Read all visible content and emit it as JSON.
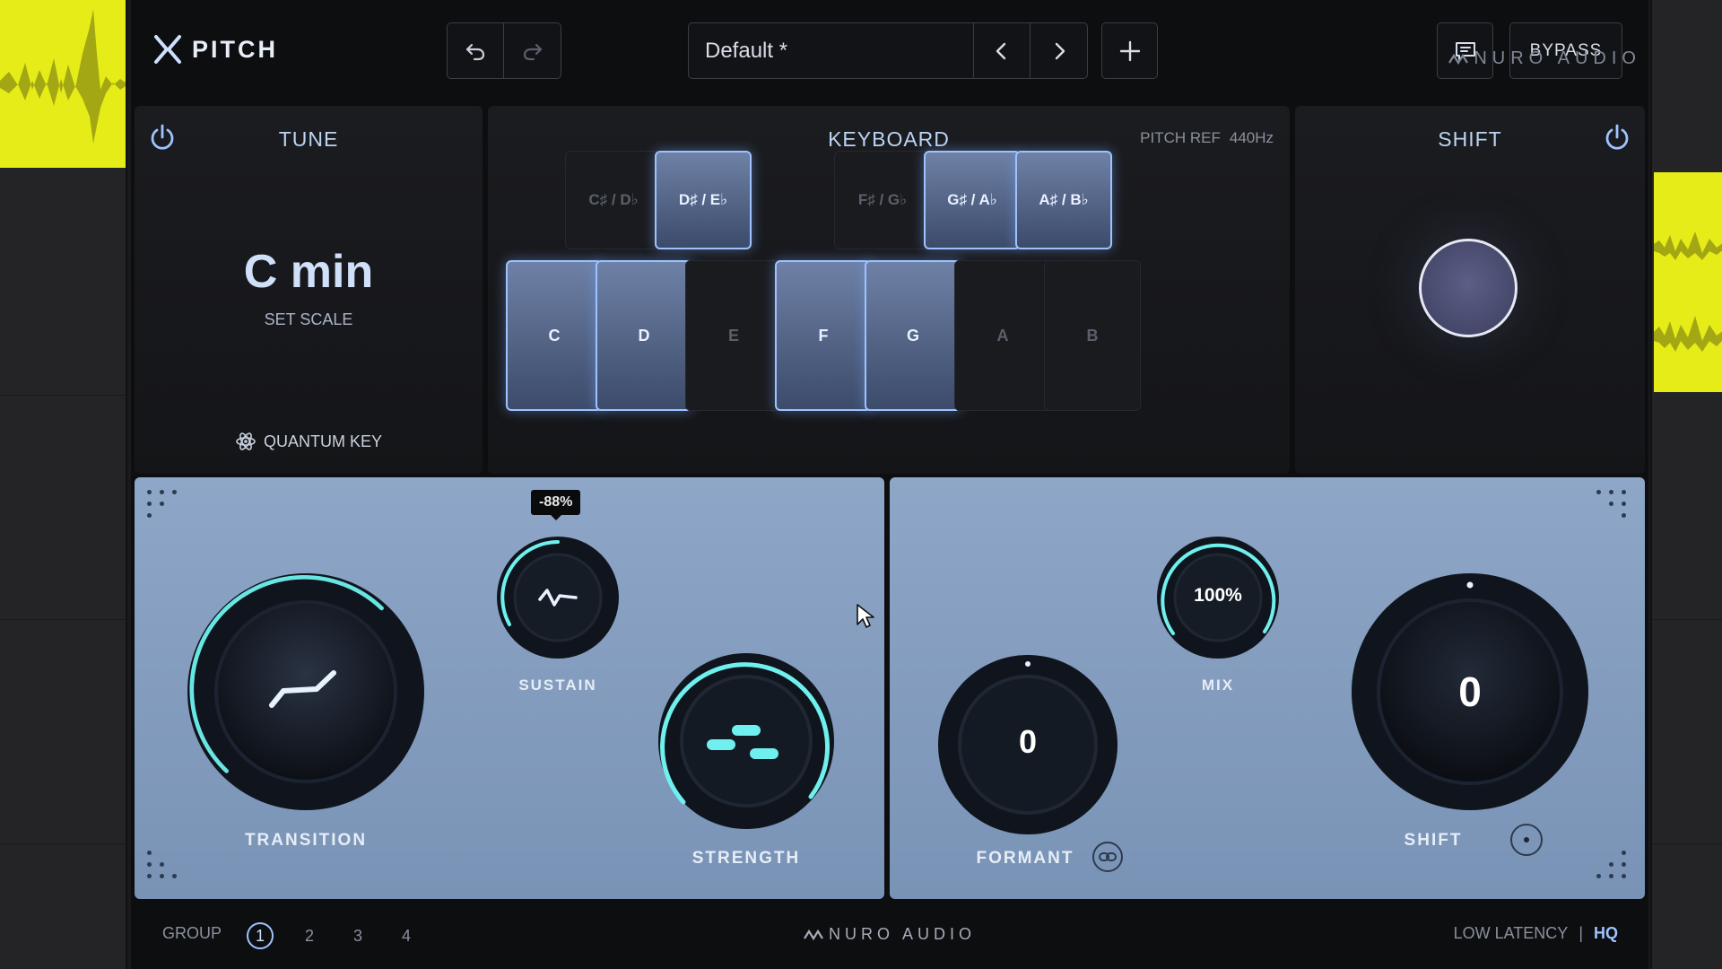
{
  "header": {
    "app_name": "PITCH",
    "preset_name": "Default *",
    "bypass_label": "BYPASS",
    "brand": "NURO AUDIO"
  },
  "tune": {
    "title": "TUNE",
    "scale": "C min",
    "set_scale_label": "SET SCALE",
    "quantum_key_label": "QUANTUM KEY"
  },
  "keyboard": {
    "title": "KEYBOARD",
    "pitch_ref_label": "PITCH REF",
    "pitch_ref_value": "440Hz",
    "black_keys": [
      {
        "label": "C♯ / D♭",
        "active": false
      },
      {
        "label": "D♯ / E♭",
        "active": true
      },
      {
        "label": "F♯ / G♭",
        "active": false
      },
      {
        "label": "G♯ / A♭",
        "active": true
      },
      {
        "label": "A♯ / B♭",
        "active": true
      }
    ],
    "white_keys": [
      {
        "label": "C",
        "active": true
      },
      {
        "label": "D",
        "active": true
      },
      {
        "label": "E",
        "active": false
      },
      {
        "label": "F",
        "active": true
      },
      {
        "label": "G",
        "active": true
      },
      {
        "label": "A",
        "active": false
      },
      {
        "label": "B",
        "active": false
      }
    ]
  },
  "shift_panel": {
    "title": "SHIFT"
  },
  "controls": {
    "transition": {
      "label": "TRANSITION",
      "level": 0.78
    },
    "sustain": {
      "label": "SUSTAIN",
      "tooltip": "-88%"
    },
    "strength": {
      "label": "STRENGTH",
      "level": 0.82
    },
    "formant": {
      "label": "FORMANT",
      "value": "0"
    },
    "mix": {
      "label": "MIX",
      "value": "100%"
    },
    "shift": {
      "label": "SHIFT",
      "value": "0"
    }
  },
  "footer": {
    "group_label": "GROUP",
    "groups": [
      "1",
      "2",
      "3",
      "4"
    ],
    "active_group": "1",
    "brand": "NURO AUDIO",
    "low_latency_label": "LOW LATENCY",
    "separator": "|",
    "hq_label": "HQ"
  },
  "colors": {
    "accent_glow": "#6ff0ee",
    "panel_blue": "#8ea6c7",
    "clip_yellow": "#e6ec18",
    "key_active_border": "#9fc2ff"
  }
}
